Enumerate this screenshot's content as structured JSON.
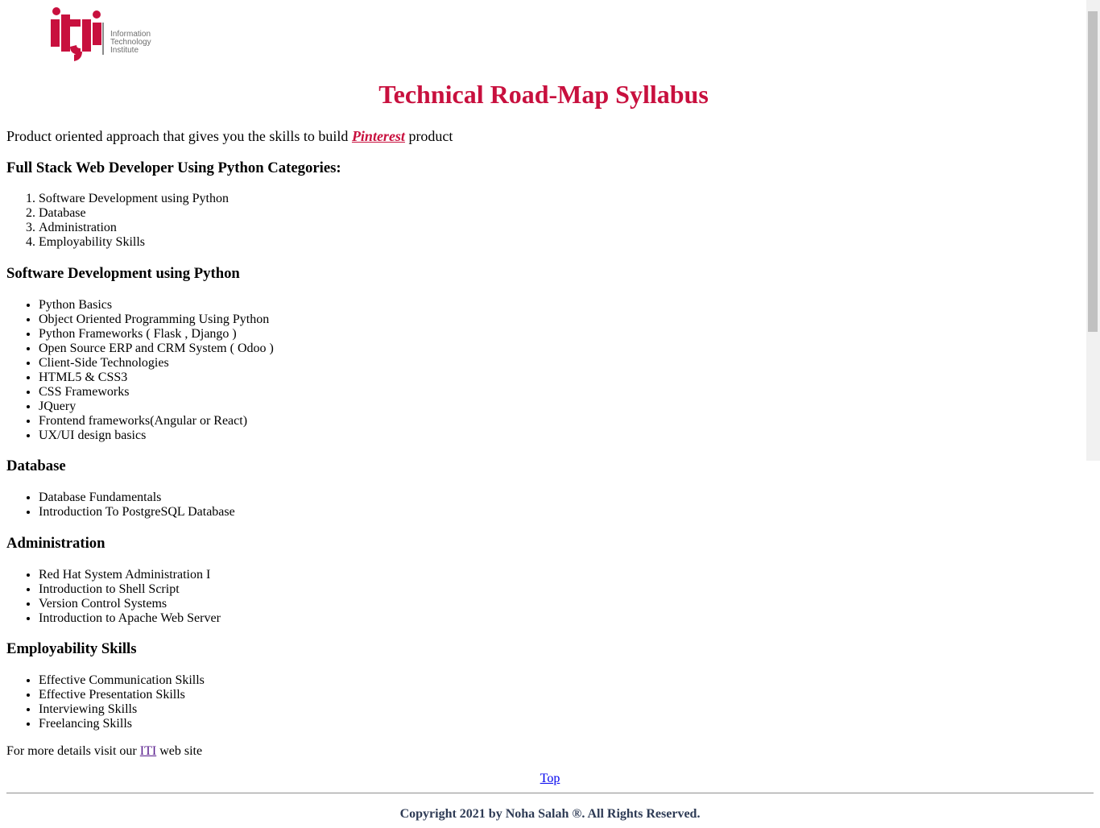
{
  "logo": {
    "line1": "Information",
    "line2": "Technology",
    "line3": "Institute"
  },
  "title": "Technical Road-Map Syllabus",
  "intro": {
    "before": "Product oriented approach that gives you the skills to build ",
    "link": "Pinterest",
    "after": " product"
  },
  "categories": {
    "heading": "Full Stack Web Developer Using Python Categories:",
    "items": [
      "Software Development using Python",
      "Database",
      "Administration",
      "Employability Skills"
    ]
  },
  "software": {
    "heading": "Software Development using Python",
    "items": [
      "Python Basics",
      "Object Oriented Programming Using Python",
      "Python Frameworks ( Flask , Django )",
      "Open Source ERP and CRM System ( Odoo )",
      "Client-Side Technologies",
      "HTML5 & CSS3",
      "CSS Frameworks",
      "JQuery",
      "Frontend frameworks(Angular or React)",
      "UX/UI design basics"
    ]
  },
  "database": {
    "heading": "Database",
    "items": [
      "Database Fundamentals",
      "Introduction To PostgreSQL Database"
    ]
  },
  "administration": {
    "heading": "Administration",
    "items": [
      "Red Hat System Administration I",
      "Introduction to Shell Script",
      "Version Control Systems",
      "Introduction to Apache Web Server"
    ]
  },
  "employability": {
    "heading": "Employability Skills",
    "items": [
      "Effective Communication Skills",
      "Effective Presentation Skills",
      "Interviewing Skills",
      "Freelancing Skills"
    ]
  },
  "footer": {
    "more_before": "For more details visit our ",
    "more_link": "ITI",
    "more_after": " web site",
    "top_link": "Top",
    "copyright": "Copyright 2021 by Noha Salah ®. All Rights Reserved."
  },
  "colors": {
    "brand_red": "#c8103e",
    "visited_link": "#551a8b",
    "link": "#0000ee"
  }
}
